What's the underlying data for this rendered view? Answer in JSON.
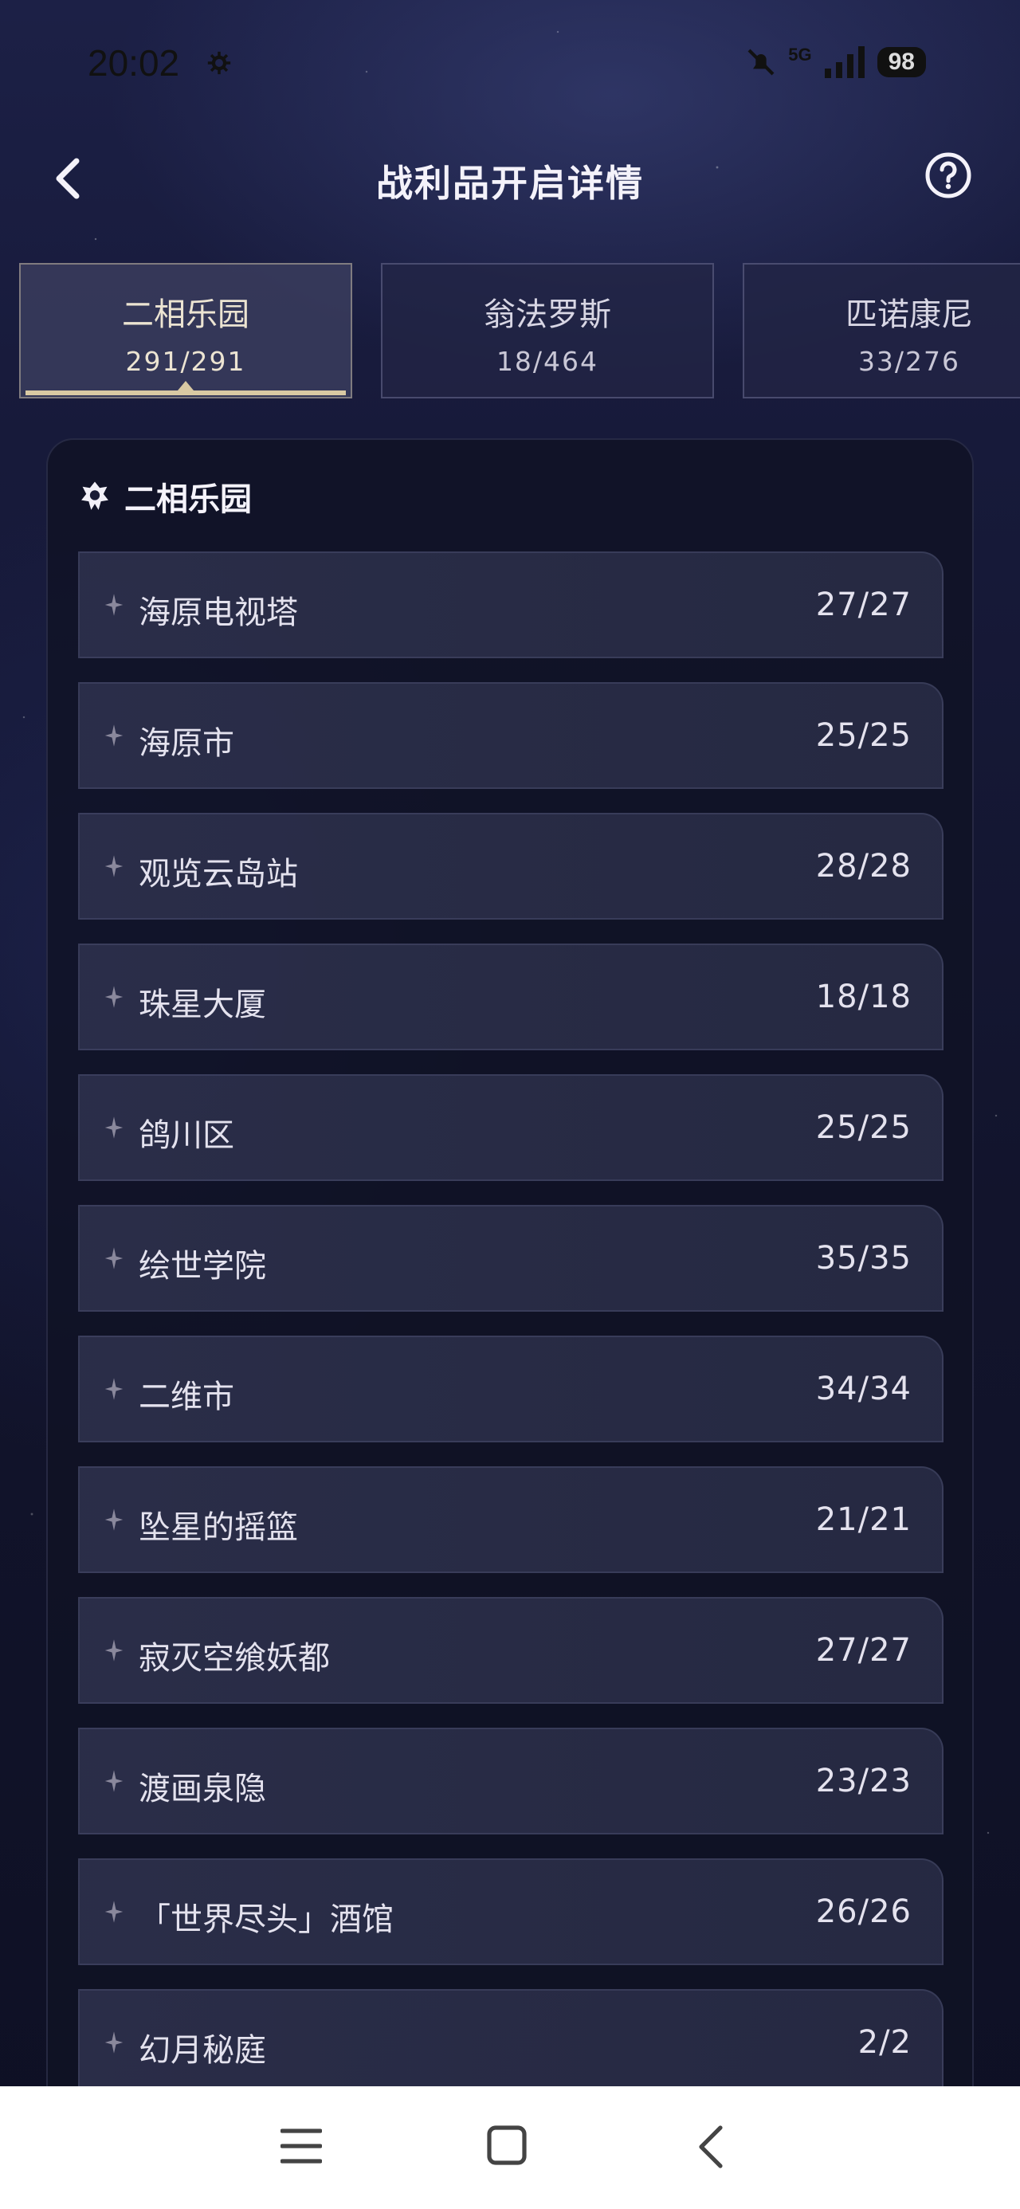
{
  "status_bar": {
    "time": "20:02",
    "network": "5G",
    "battery": "98"
  },
  "header": {
    "title": "战利品开启详情"
  },
  "tabs": [
    {
      "name": "二相乐园",
      "count": "291/291",
      "active": true
    },
    {
      "name": "翁法罗斯",
      "count": "18/464",
      "active": false
    },
    {
      "name": "匹诺康尼",
      "count": "33/276",
      "active": false
    }
  ],
  "region": {
    "title": "二相乐园",
    "items": [
      {
        "name": "海原电视塔",
        "count": "27/27"
      },
      {
        "name": "海原市",
        "count": "25/25"
      },
      {
        "name": "观览云岛站",
        "count": "28/28"
      },
      {
        "name": "珠星大厦",
        "count": "18/18"
      },
      {
        "name": "鸽川区",
        "count": "25/25"
      },
      {
        "name": "绘世学院",
        "count": "35/35"
      },
      {
        "name": "二维市",
        "count": "34/34"
      },
      {
        "name": "坠星的摇篮",
        "count": "21/21"
      },
      {
        "name": "寂灭空飨妖都",
        "count": "27/27"
      },
      {
        "name": "渡画泉隐",
        "count": "23/23"
      },
      {
        "name": "「世界尽头」酒馆",
        "count": "26/26"
      },
      {
        "name": "幻月秘庭",
        "count": "2/2"
      }
    ]
  },
  "colors": {
    "accent": "#d9c9a3",
    "background": "#141634",
    "nav_bar": "#ffffff"
  }
}
